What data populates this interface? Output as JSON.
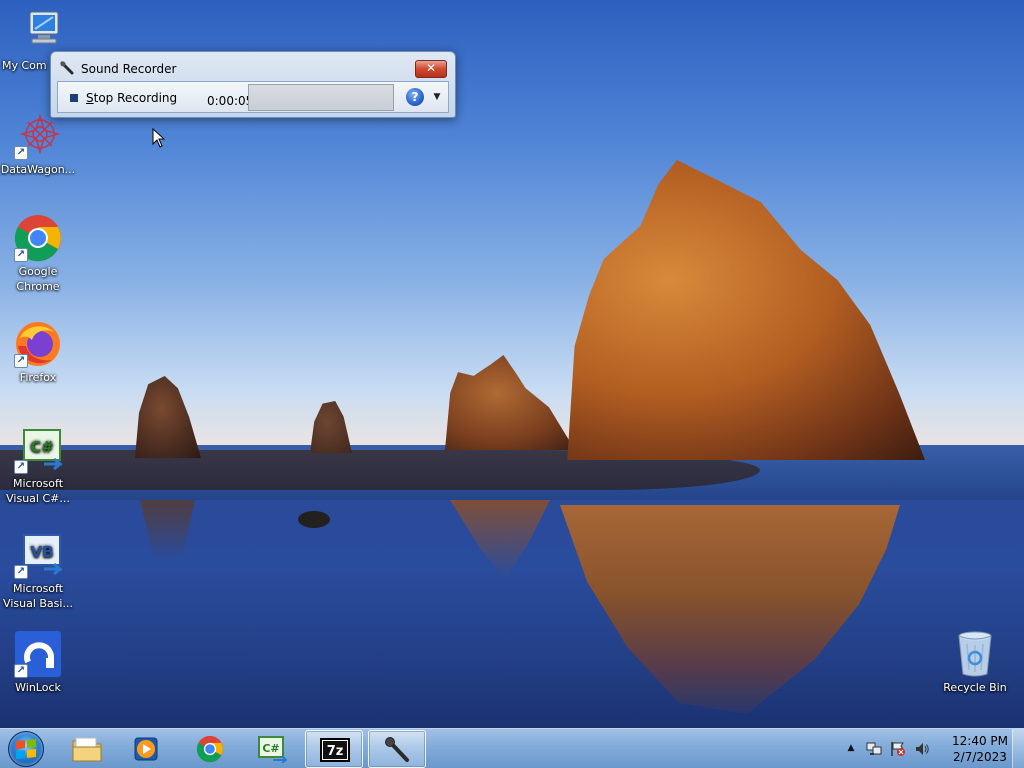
{
  "desktop": {
    "icons": [
      {
        "label": "My Com",
        "name": "my-computer"
      },
      {
        "label": "DataWagon...",
        "name": "datawagon"
      },
      {
        "label": "Google Chrome",
        "name": "google-chrome"
      },
      {
        "label": "Firefox",
        "name": "firefox"
      },
      {
        "label": "Microsoft Visual C#...",
        "name": "visual-csharp"
      },
      {
        "label": "Microsoft Visual Basi...",
        "name": "visual-basic"
      },
      {
        "label": "WinLock",
        "name": "winlock"
      },
      {
        "label": "Recycle Bin",
        "name": "recycle-bin"
      }
    ],
    "shortcut_glyph": "↗"
  },
  "recorder": {
    "title": "Sound Recorder",
    "close_glyph": "✕",
    "stop_label": "Stop Recording",
    "stop_mnemonic": "S",
    "stop_rest": "top Recording",
    "elapsed": "0:00:05",
    "level": 0,
    "help_glyph": "?",
    "dropdown_glyph": "▼"
  },
  "taskbar": {
    "start_icon": "windows-start-orb",
    "pinned": [
      {
        "name": "windows-explorer",
        "icon": "folder-icon"
      },
      {
        "name": "windows-media-player",
        "icon": "media-player-icon"
      },
      {
        "name": "google-chrome",
        "icon": "chrome-icon"
      },
      {
        "name": "visual-csharp",
        "icon": "csharp-icon"
      },
      {
        "name": "7-zip",
        "icon": "7zip-icon",
        "text": "7z",
        "active": true
      },
      {
        "name": "sound-recorder",
        "icon": "microphone-icon",
        "active": true
      }
    ],
    "csharp_text": "C#",
    "vb_text": "VB",
    "tray": {
      "expand_glyph": "▲",
      "time": "12:40 PM",
      "date": "2/7/2023"
    }
  },
  "colors": {
    "taskbar": "#8cb4dc",
    "close_button": "#cf4a31",
    "help_button": "#2a63c9"
  }
}
